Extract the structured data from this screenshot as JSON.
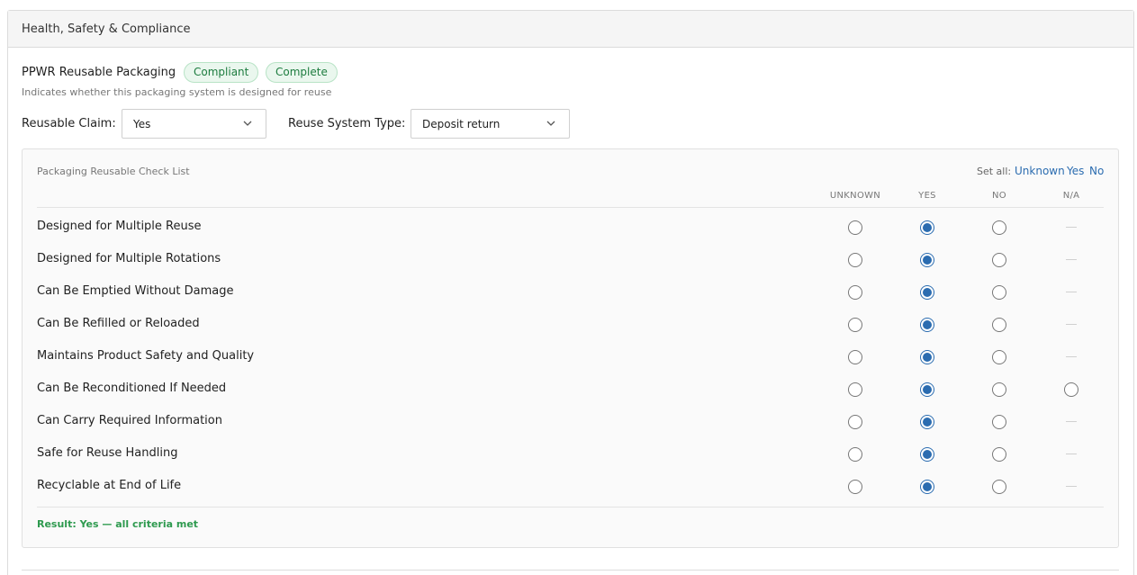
{
  "panel": {
    "title": "Health, Safety & Compliance"
  },
  "section": {
    "title": "PPWR Reusable Packaging",
    "badges": [
      "Compliant",
      "Complete"
    ],
    "description": "Indicates whether this packaging system is designed for reuse"
  },
  "fields": {
    "reusable_claim": {
      "label": "Reusable Claim:",
      "value": "Yes"
    },
    "reuse_system_type": {
      "label": "Reuse System Type:",
      "value": "Deposit return"
    }
  },
  "checklist": {
    "title": "Packaging Reusable Check List",
    "set_all_label": "Set all:",
    "set_all_options": [
      "Unknown",
      "Yes",
      "No"
    ],
    "columns": [
      "UNKNOWN",
      "YES",
      "NO",
      "N/A"
    ],
    "rows": [
      {
        "label": "Designed for Multiple Reuse",
        "value": "YES",
        "na_available": false
      },
      {
        "label": "Designed for Multiple Rotations",
        "value": "YES",
        "na_available": false
      },
      {
        "label": "Can Be Emptied Without Damage",
        "value": "YES",
        "na_available": false
      },
      {
        "label": "Can Be Refilled or Reloaded",
        "value": "YES",
        "na_available": false
      },
      {
        "label": "Maintains Product Safety and Quality",
        "value": "YES",
        "na_available": false
      },
      {
        "label": "Can Be Reconditioned If Needed",
        "value": "YES",
        "na_available": true
      },
      {
        "label": "Can Carry Required Information",
        "value": "YES",
        "na_available": false
      },
      {
        "label": "Safe for Reuse Handling",
        "value": "YES",
        "na_available": false
      },
      {
        "label": "Recyclable at End of Life",
        "value": "YES",
        "na_available": false
      }
    ],
    "result": "Result: Yes — all criteria met"
  },
  "colors": {
    "accent": "#2b6cb0",
    "success": "#2e9a4f",
    "badge_bg": "#eaf7ee"
  }
}
